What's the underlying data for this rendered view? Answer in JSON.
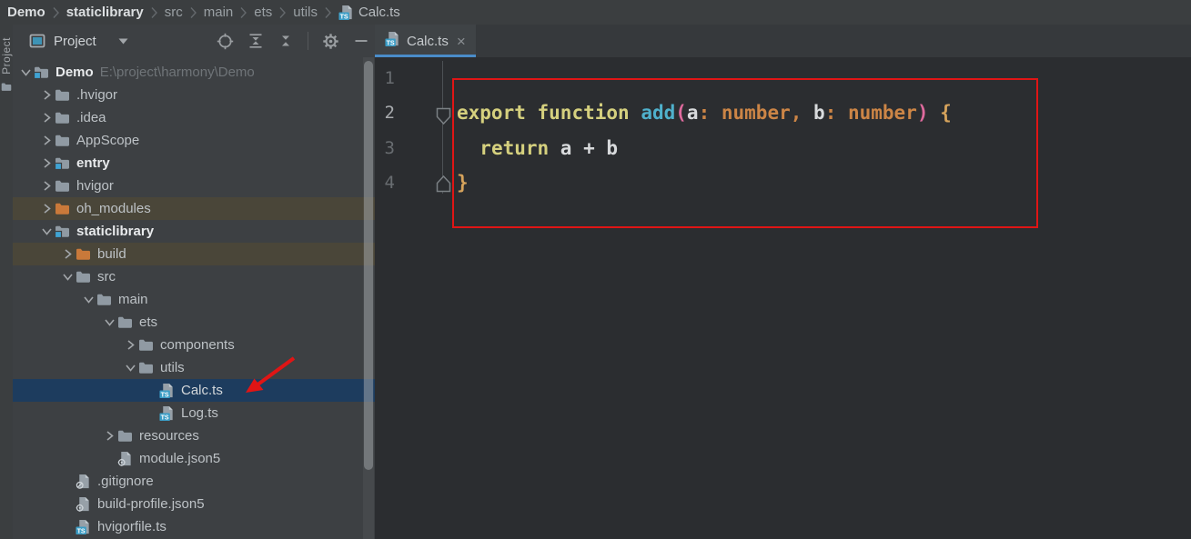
{
  "breadcrumb": {
    "items": [
      {
        "label": "Demo",
        "bold": true
      },
      {
        "label": "staticlibrary",
        "bold": true
      },
      {
        "label": "src"
      },
      {
        "label": "main"
      },
      {
        "label": "ets"
      },
      {
        "label": "utils"
      },
      {
        "label": "Calc.ts",
        "icon": "ts-file"
      }
    ]
  },
  "left_strip": {
    "label": "Project"
  },
  "project_panel": {
    "title": "Project",
    "toolbar": [
      "locate-icon",
      "expand-all-icon",
      "collapse-all-icon",
      "divider",
      "settings-icon",
      "hide-icon"
    ],
    "tree": [
      {
        "label": "Demo",
        "level": 0,
        "chevron": "expanded",
        "icon": "module-folder",
        "bold": true,
        "path": "E:\\project\\harmony\\Demo"
      },
      {
        "label": ".hvigor",
        "level": 1,
        "chevron": "collapsed",
        "icon": "folder"
      },
      {
        "label": ".idea",
        "level": 1,
        "chevron": "collapsed",
        "icon": "folder"
      },
      {
        "label": "AppScope",
        "level": 1,
        "chevron": "collapsed",
        "icon": "folder"
      },
      {
        "label": "entry",
        "level": 1,
        "chevron": "collapsed",
        "icon": "module-folder",
        "bold": true
      },
      {
        "label": "hvigor",
        "level": 1,
        "chevron": "collapsed",
        "icon": "folder"
      },
      {
        "label": "oh_modules",
        "level": 1,
        "chevron": "collapsed",
        "icon": "folder-excluded",
        "row": "excluded"
      },
      {
        "label": "staticlibrary",
        "level": 1,
        "chevron": "expanded",
        "icon": "module-folder",
        "bold": true
      },
      {
        "label": "build",
        "level": 2,
        "chevron": "collapsed",
        "icon": "folder-excluded",
        "row": "excluded"
      },
      {
        "label": "src",
        "level": 2,
        "chevron": "expanded",
        "icon": "folder"
      },
      {
        "label": "main",
        "level": 3,
        "chevron": "expanded",
        "icon": "folder"
      },
      {
        "label": "ets",
        "level": 4,
        "chevron": "expanded",
        "icon": "folder"
      },
      {
        "label": "components",
        "level": 5,
        "chevron": "collapsed",
        "icon": "folder"
      },
      {
        "label": "utils",
        "level": 5,
        "chevron": "expanded",
        "icon": "folder"
      },
      {
        "label": "Calc.ts",
        "level": 6,
        "chevron": "none",
        "icon": "ts-file",
        "row": "selected"
      },
      {
        "label": "Log.ts",
        "level": 6,
        "chevron": "none",
        "icon": "ts-file"
      },
      {
        "label": "resources",
        "level": 4,
        "chevron": "collapsed",
        "icon": "folder"
      },
      {
        "label": "module.json5",
        "level": 4,
        "chevron": "none",
        "icon": "json-file"
      },
      {
        "label": ".gitignore",
        "level": 2,
        "chevron": "none",
        "icon": "git-file"
      },
      {
        "label": "build-profile.json5",
        "level": 2,
        "chevron": "none",
        "icon": "json-file"
      },
      {
        "label": "hvigorfile.ts",
        "level": 2,
        "chevron": "none",
        "icon": "ts-file"
      }
    ]
  },
  "editor": {
    "tab": {
      "label": "Calc.ts",
      "icon": "ts-file",
      "close_label": "×"
    },
    "line_numbers": [
      "1",
      "2",
      "3",
      "4"
    ],
    "current_line": "2",
    "code_lines": [
      {
        "tokens": []
      },
      {
        "tokens": [
          {
            "t": "export",
            "c": "kw"
          },
          {
            "t": " ",
            "c": "p"
          },
          {
            "t": "function",
            "c": "kw"
          },
          {
            "t": " ",
            "c": "p"
          },
          {
            "t": "add",
            "c": "fn"
          },
          {
            "t": "(",
            "c": "br"
          },
          {
            "t": "a",
            "c": "p"
          },
          {
            "t": ": ",
            "c": "op"
          },
          {
            "t": "number",
            "c": "ty"
          },
          {
            "t": ", ",
            "c": "op"
          },
          {
            "t": "b",
            "c": "p"
          },
          {
            "t": ": ",
            "c": "op"
          },
          {
            "t": "number",
            "c": "ty"
          },
          {
            "t": ")",
            "c": "br"
          },
          {
            "t": " ",
            "c": "p"
          },
          {
            "t": "{",
            "c": "cu"
          }
        ]
      },
      {
        "tokens": [
          {
            "t": "  ",
            "c": "p"
          },
          {
            "t": "return",
            "c": "kw"
          },
          {
            "t": " a + b",
            "c": "p"
          }
        ]
      },
      {
        "tokens": [
          {
            "t": "}",
            "c": "cu"
          }
        ]
      }
    ]
  },
  "colors": {
    "accent_blue": "#4a8cc9",
    "selection_blue": "#1d3c5e",
    "excluded_row_brown": "#4a4639",
    "annotation_red": "#e01515",
    "folder_gray": "#909aa3",
    "folder_orange": "#c9793a",
    "module_badge_cyan": "#3fa3d4",
    "ts_badge_blue": "#3b9dc6",
    "syntax": {
      "keyword": "#d5d07e",
      "function_name": "#4fb1cc",
      "type": "#cc8546",
      "punctuation": "#cc8546",
      "paren": "#df6a9d",
      "brace": "#d6a35c",
      "default": "#d8dadc"
    }
  }
}
